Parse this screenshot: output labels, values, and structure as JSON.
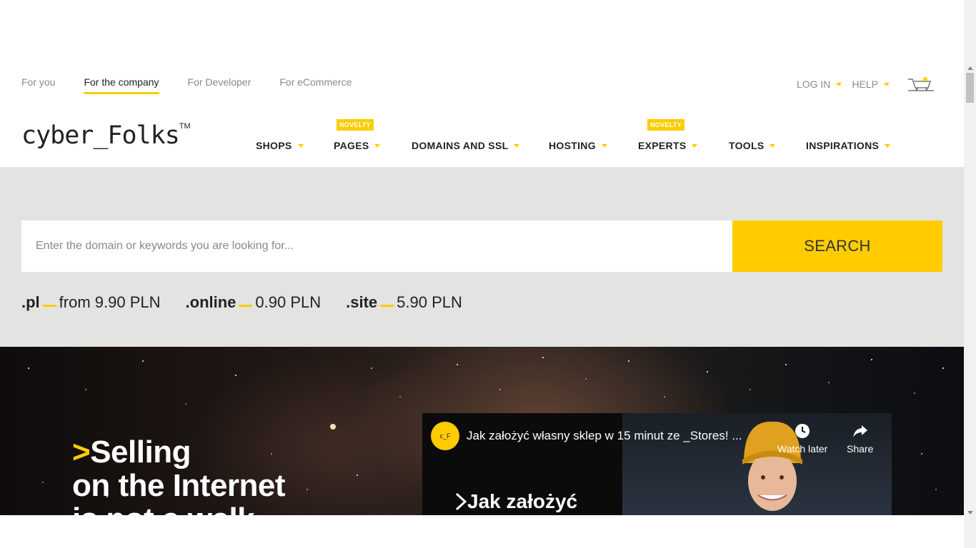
{
  "topnav": {
    "items": [
      "For you",
      "For the company",
      "For Developer",
      "For eCommerce"
    ],
    "active": "For the company"
  },
  "topright": {
    "login": "LOG IN",
    "help": "HELP"
  },
  "logo": {
    "text": "cyber_Folks",
    "tm": "TM"
  },
  "mainnav": {
    "items": [
      {
        "label": "SHOPS"
      },
      {
        "label": "PAGES",
        "badge": "NOVELTY"
      },
      {
        "label": "DOMAINS AND SSL"
      },
      {
        "label": "HOSTING"
      },
      {
        "label": "EXPERTS",
        "badge": "NOVELTY"
      },
      {
        "label": "TOOLS"
      },
      {
        "label": "INSPIRATIONS"
      }
    ]
  },
  "search": {
    "placeholder": "Enter the domain or keywords you are looking for...",
    "button": "SEARCH"
  },
  "prices": [
    {
      "tld": ".pl",
      "price": "from 9.90 PLN"
    },
    {
      "tld": ".online",
      "price": "0.90 PLN"
    },
    {
      "tld": ".site",
      "price": "5.90 PLN"
    }
  ],
  "hero": {
    "gt": ">",
    "line1": "Selling",
    "line2": "on the Internet",
    "line3": "is not a walk"
  },
  "video": {
    "channel": "c_F",
    "title": "Jak założyć własny sklep w 15 minut ze _Stores! ...",
    "watch_later": "Watch later",
    "share": "Share",
    "overlay_text": "Jak założyć"
  },
  "colors": {
    "accent": "#ffcc00",
    "band": "#e3e4e2"
  }
}
